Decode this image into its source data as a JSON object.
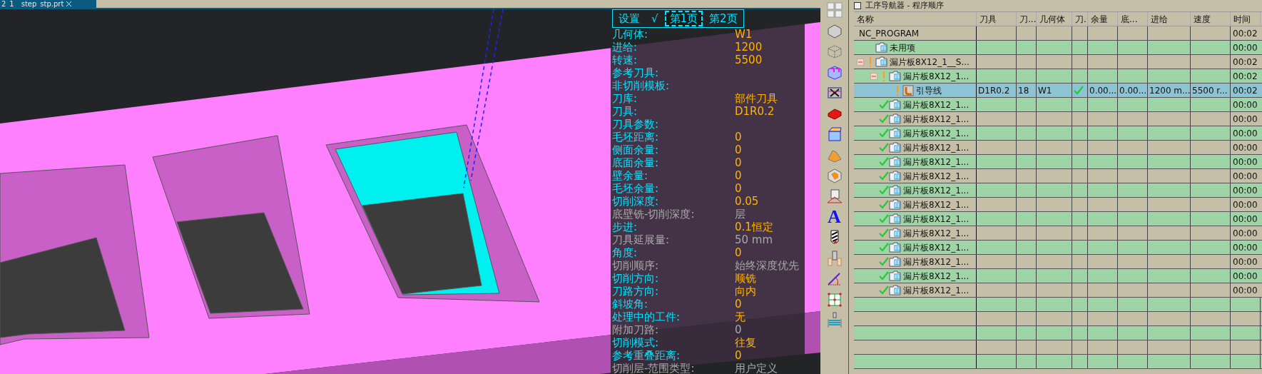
{
  "tab": {
    "title": "2_1__step_stp.prt"
  },
  "overlay": {
    "header": [
      {
        "label": "设置",
        "selected": false
      },
      {
        "label": "√",
        "selected": false
      },
      {
        "label": "第1页",
        "selected": true
      },
      {
        "label": "第2页",
        "selected": false
      }
    ],
    "rows": [
      {
        "label": "几何体:",
        "value": "W1",
        "disabled": false
      },
      {
        "label": "进给:",
        "value": "1200",
        "disabled": false
      },
      {
        "label": "转速:",
        "value": "5500",
        "disabled": false
      },
      {
        "label": "参考刀具:",
        "disabled": false
      },
      {
        "label": "非切削模板:",
        "disabled": false
      },
      {
        "label": "刀库:",
        "value": "部件刀具",
        "disabled": false
      },
      {
        "label": "刀具:",
        "value": "D1R0.2",
        "disabled": false
      },
      {
        "label": "刀具参数:",
        "disabled": false
      },
      {
        "label": "毛坯距离:",
        "value": "0",
        "disabled": false
      },
      {
        "label": "侧面余量:",
        "value": "0",
        "disabled": false
      },
      {
        "label": "底面余量:",
        "value": "0",
        "disabled": false
      },
      {
        "label": "壁余量:",
        "value": "0",
        "disabled": false
      },
      {
        "label": "毛坯余量:",
        "value": "0",
        "disabled": false
      },
      {
        "label": "切削深度:",
        "value": "0.05",
        "disabled": false
      },
      {
        "label": "底壁铣-切削深度:",
        "value": "层",
        "disabled": true
      },
      {
        "label": "步进:",
        "value": "0.1恒定",
        "disabled": false
      },
      {
        "label": "刀具延展量:",
        "value": "50 mm",
        "disabled": true
      },
      {
        "label": "角度:",
        "value": "0",
        "disabled": false
      },
      {
        "label": "切削顺序:",
        "value": "始终深度优先",
        "disabled": true
      },
      {
        "label": "切削方向:",
        "value": "顺铣",
        "disabled": false
      },
      {
        "label": "刀路方向:",
        "value": "向内",
        "disabled": false
      },
      {
        "label": "斜坡角:",
        "value": "0",
        "disabled": false
      },
      {
        "label": "处理中的工件:",
        "value": "无",
        "disabled": false
      },
      {
        "label": "附加刀路:",
        "value": "0",
        "disabled": true
      },
      {
        "label": "切削模式:",
        "value": "往复",
        "disabled": false
      },
      {
        "label": "参考重叠距离:",
        "value": "0",
        "disabled": false
      },
      {
        "label": "切削层-范围类型:",
        "value": "用户定义",
        "disabled": true
      }
    ]
  },
  "toolbar": {
    "text_glyph": "A"
  },
  "navigator": {
    "title": "工序导航器 - 程序顺序",
    "columns": [
      "名称",
      "刀具",
      "刀...",
      "几何体",
      "刀.",
      "余量",
      "底...",
      "进给",
      "速度",
      "时间"
    ],
    "rows": [
      {
        "name": "NC_PROGRAM",
        "kind": "root",
        "time": "00:02",
        "selected": false
      },
      {
        "name": "未用项",
        "kind": "group",
        "time": "00:00",
        "selected": false
      },
      {
        "name": "漏片板8X12_1__S...",
        "kind": "program",
        "completed": false,
        "expanded": true,
        "time": "00:02",
        "selected": false,
        "children": [
          {
            "name": "漏片板8X12_1...",
            "kind": "program",
            "completed": false,
            "expanded": true,
            "time": "00:02",
            "selected": false,
            "children": [
              {
                "name": "引导线",
                "kind": "operation",
                "completed": false,
                "time": "00:02",
                "selected": true,
                "cells": [
                  {
                    "text": "D1R0.2"
                  },
                  {
                    "text": "18"
                  },
                  {
                    "text": "W1"
                  },
                  {
                    "check": true
                  },
                  {
                    "text": "0.00..."
                  },
                  {
                    "text": "0.00..."
                  },
                  {
                    "text": "1200 m..."
                  },
                  {
                    "text": "5500 r..."
                  }
                ]
              }
            ]
          },
          {
            "name": "漏片板8X12_1...",
            "kind": "program",
            "completed": true,
            "time": "00:00",
            "selected": false
          },
          {
            "name": "漏片板8X12_1...",
            "kind": "program",
            "completed": true,
            "time": "00:00",
            "selected": false
          },
          {
            "name": "漏片板8X12_1...",
            "kind": "program",
            "completed": true,
            "time": "00:00",
            "selected": false
          },
          {
            "name": "漏片板8X12_1...",
            "kind": "program",
            "completed": true,
            "time": "00:00",
            "selected": false
          },
          {
            "name": "漏片板8X12_1...",
            "kind": "program",
            "completed": true,
            "time": "00:00",
            "selected": false
          },
          {
            "name": "漏片板8X12_1...",
            "kind": "program",
            "completed": true,
            "time": "00:00",
            "selected": false
          },
          {
            "name": "漏片板8X12_1...",
            "kind": "program",
            "completed": true,
            "time": "00:00",
            "selected": false
          },
          {
            "name": "漏片板8X12_1...",
            "kind": "program",
            "completed": true,
            "time": "00:00",
            "selected": false
          },
          {
            "name": "漏片板8X12_1...",
            "kind": "program",
            "completed": true,
            "time": "00:00",
            "selected": false
          },
          {
            "name": "漏片板8X12_1...",
            "kind": "program",
            "completed": true,
            "time": "00:00",
            "selected": false
          },
          {
            "name": "漏片板8X12_1...",
            "kind": "program",
            "completed": true,
            "time": "00:00",
            "selected": false
          },
          {
            "name": "漏片板8X12_1...",
            "kind": "program",
            "completed": true,
            "time": "00:00",
            "selected": false
          },
          {
            "name": "漏片板8X12_1...",
            "kind": "program",
            "completed": true,
            "time": "00:00",
            "selected": false
          },
          {
            "name": "漏片板8X12_1...",
            "kind": "program",
            "completed": true,
            "time": "00:00",
            "selected": false
          }
        ]
      }
    ]
  }
}
